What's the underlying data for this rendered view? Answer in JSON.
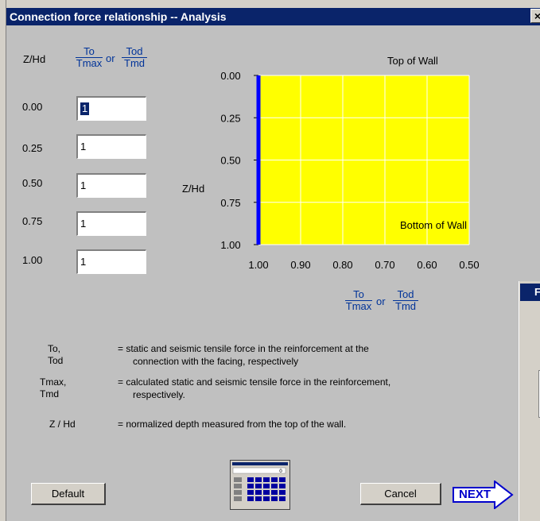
{
  "window": {
    "title": "Connection force relationship -- Analysis",
    "close_glyph": "×"
  },
  "left_header": {
    "zhd": "Z/Hd",
    "frac1_num": "To",
    "frac1_den": "Tmax",
    "or": "or",
    "frac2_num": "Tod",
    "frac2_den": "Tmd"
  },
  "rows": [
    {
      "label": "0.00",
      "value": "1"
    },
    {
      "label": "0.25",
      "value": "1"
    },
    {
      "label": "0.50",
      "value": "1"
    },
    {
      "label": "0.75",
      "value": "1"
    },
    {
      "label": "1.00",
      "value": "1"
    }
  ],
  "chart_data": {
    "type": "line",
    "title": "",
    "top_annotation": "Top of Wall",
    "bottom_annotation": "Bottom of Wall",
    "ylabel": "Z/Hd",
    "xlabel_frac1_num": "To",
    "xlabel_frac1_den": "Tmax",
    "xlabel_or": "or",
    "xlabel_frac2_num": "Tod",
    "xlabel_frac2_den": "Tmd",
    "xlim": [
      1.0,
      0.5
    ],
    "ylim": [
      0.0,
      1.0
    ],
    "x_ticks": [
      "1.00",
      "0.90",
      "0.80",
      "0.70",
      "0.60",
      "0.50"
    ],
    "y_ticks": [
      "0.00",
      "0.25",
      "0.50",
      "0.75",
      "1.00"
    ],
    "grid": true,
    "plot_color": "#ffff00",
    "line_color": "#0000ff",
    "series": [
      {
        "x": [
          1,
          1,
          1,
          1,
          1
        ],
        "y": [
          0.0,
          0.25,
          0.5,
          0.75,
          1.0
        ]
      }
    ]
  },
  "definitions": [
    {
      "term": "To, Tod",
      "text": "=  static and seismic tensile force in the reinforcement at the",
      "text2": "connection with the facing, respectively"
    },
    {
      "term": "Tmax, Tmd",
      "text": "=  calculated static and seismic tensile force in the reinforcement,",
      "text2": "respectively."
    },
    {
      "term": "Z / Hd",
      "text": "=  normalized depth measured from the top of the wall.",
      "text2": ""
    }
  ],
  "buttons": {
    "default": "Default",
    "cancel": "Cancel",
    "next": "NEXT"
  },
  "icons": {
    "calculator": "calculator-icon",
    "next": "next-arrow-icon"
  }
}
